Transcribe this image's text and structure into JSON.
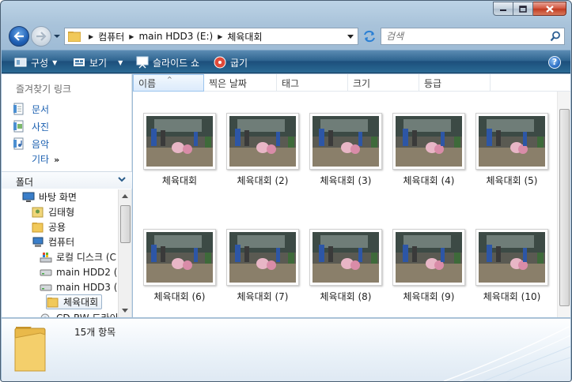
{
  "window": {
    "caption_minimize": "minimize",
    "caption_maximize": "maximize",
    "caption_close": "close"
  },
  "address": {
    "crumbs": [
      "컴퓨터",
      "main HDD3 (E:)",
      "체육대회"
    ]
  },
  "search": {
    "placeholder": "검색"
  },
  "commands": {
    "organize": "구성",
    "views": "보기",
    "slideshow": "슬라이드 쇼",
    "burn": "굽기"
  },
  "nav": {
    "favorites_title": "즐겨찾기 링크",
    "favorites": [
      "문서",
      "사진",
      "음악"
    ],
    "more": "기타",
    "more_chev": "»",
    "folders_label": "폴더",
    "tree": [
      "바탕 화면",
      "김태형",
      "공용",
      "컴퓨터",
      "로컬 디스크 (C",
      "main HDD2 (D",
      "main HDD3 (E",
      "체육대회",
      "CD-RW 드라이"
    ]
  },
  "columns": [
    "이름",
    "찍은 날짜",
    "태그",
    "크기",
    "등급"
  ],
  "files": [
    "체육대회",
    "체육대회 (2)",
    "체육대회 (3)",
    "체육대회 (4)",
    "체육대회 (5)",
    "체육대회 (6)",
    "체육대회 (7)",
    "체육대회 (8)",
    "체육대회 (9)",
    "체육대회 (10)"
  ],
  "details": {
    "count": "15개 항목"
  }
}
